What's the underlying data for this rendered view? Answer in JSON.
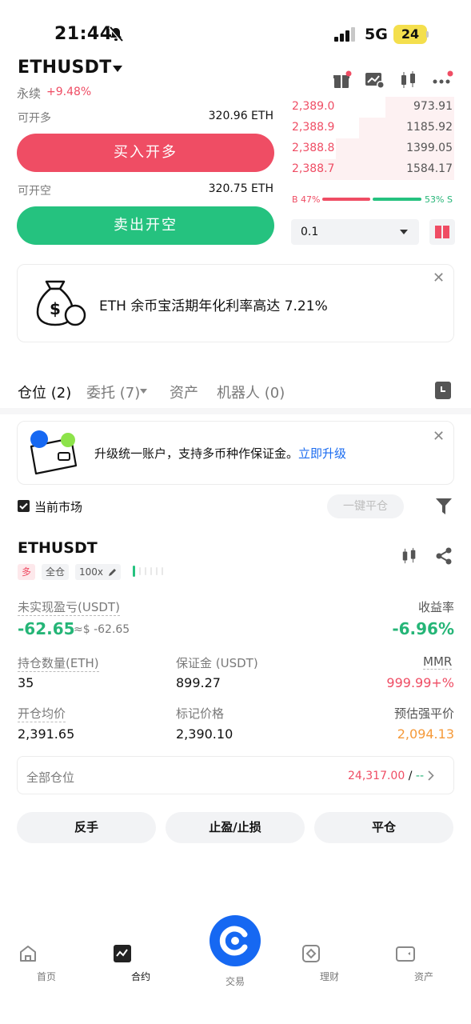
{
  "status": {
    "time": "21:44",
    "network": "5G",
    "battery": "24"
  },
  "header": {
    "pair": "ETHUSDT",
    "perp_label": "永续",
    "change": "+9.48%"
  },
  "trade": {
    "can_long_label": "可开多",
    "can_long_value": "320.96 ETH",
    "buy_label": "买入开多",
    "can_short_label": "可开空",
    "can_short_value": "320.75 ETH",
    "sell_label": "卖出开空"
  },
  "orderbook": {
    "asks": [
      {
        "price": "2,389.0",
        "qty": "973.91",
        "depth": 0.42
      },
      {
        "price": "2,388.9",
        "qty": "1185.92",
        "depth": 0.58
      },
      {
        "price": "2,388.8",
        "qty": "1399.05",
        "depth": 0.72
      },
      {
        "price": "2,388.7",
        "qty": "1584.17",
        "depth": 0.82
      }
    ],
    "buy_ratio": "B 47%",
    "sell_ratio": "53% S",
    "quantity": "0.1"
  },
  "promo": {
    "text": "ETH 余币宝活期年化利率高达 7.21%"
  },
  "tabs": [
    {
      "label": "仓位 (2)"
    },
    {
      "label": "委托 (7)"
    },
    {
      "label": "资产"
    },
    {
      "label": "机器人 (0)"
    }
  ],
  "upgrade": {
    "text": "升级统一账户，支持多币种作保证金。",
    "link": "立即升级"
  },
  "filter": {
    "current_market": "当前市场",
    "close_all": "一键平仓"
  },
  "position": {
    "symbol": "ETHUSDT",
    "side_tag": "多",
    "margin_tag": "全仓",
    "leverage_tag": "100x",
    "upl_label": "未实现盈亏(USDT)",
    "upl_value": "-62.65",
    "upl_usd": "≈$ -62.65",
    "roi_label": "收益率",
    "roi_value": "-6.96%",
    "size_label": "持仓数量(ETH)",
    "size_value": "35",
    "margin_label": "保证金 (USDT)",
    "margin_value": "899.27",
    "mmr_label": "MMR",
    "mmr_value": "999.99+%",
    "entry_label": "开仓均价",
    "entry_value": "2,391.65",
    "mark_label": "标记价格",
    "mark_value": "2,390.10",
    "liq_label": "预估强平价",
    "liq_value": "2,094.13"
  },
  "all_positions": {
    "label": "全部仓位",
    "value": "24,317.00",
    "slash": "/",
    "dash": "--"
  },
  "actions": {
    "reverse": "反手",
    "tpsl": "止盈/止损",
    "close": "平仓"
  },
  "nav": [
    {
      "label": "首页",
      "icon": "home-icon"
    },
    {
      "label": "合约",
      "icon": "futures-icon"
    },
    {
      "label": "交易",
      "icon": "trade-icon"
    },
    {
      "label": "理财",
      "icon": "earn-icon"
    },
    {
      "label": "资产",
      "icon": "wallet-icon"
    }
  ],
  "colors": {
    "red": "#ef4d64",
    "green": "#25c27f",
    "blue": "#1668f2",
    "orange": "#f59a3a"
  }
}
